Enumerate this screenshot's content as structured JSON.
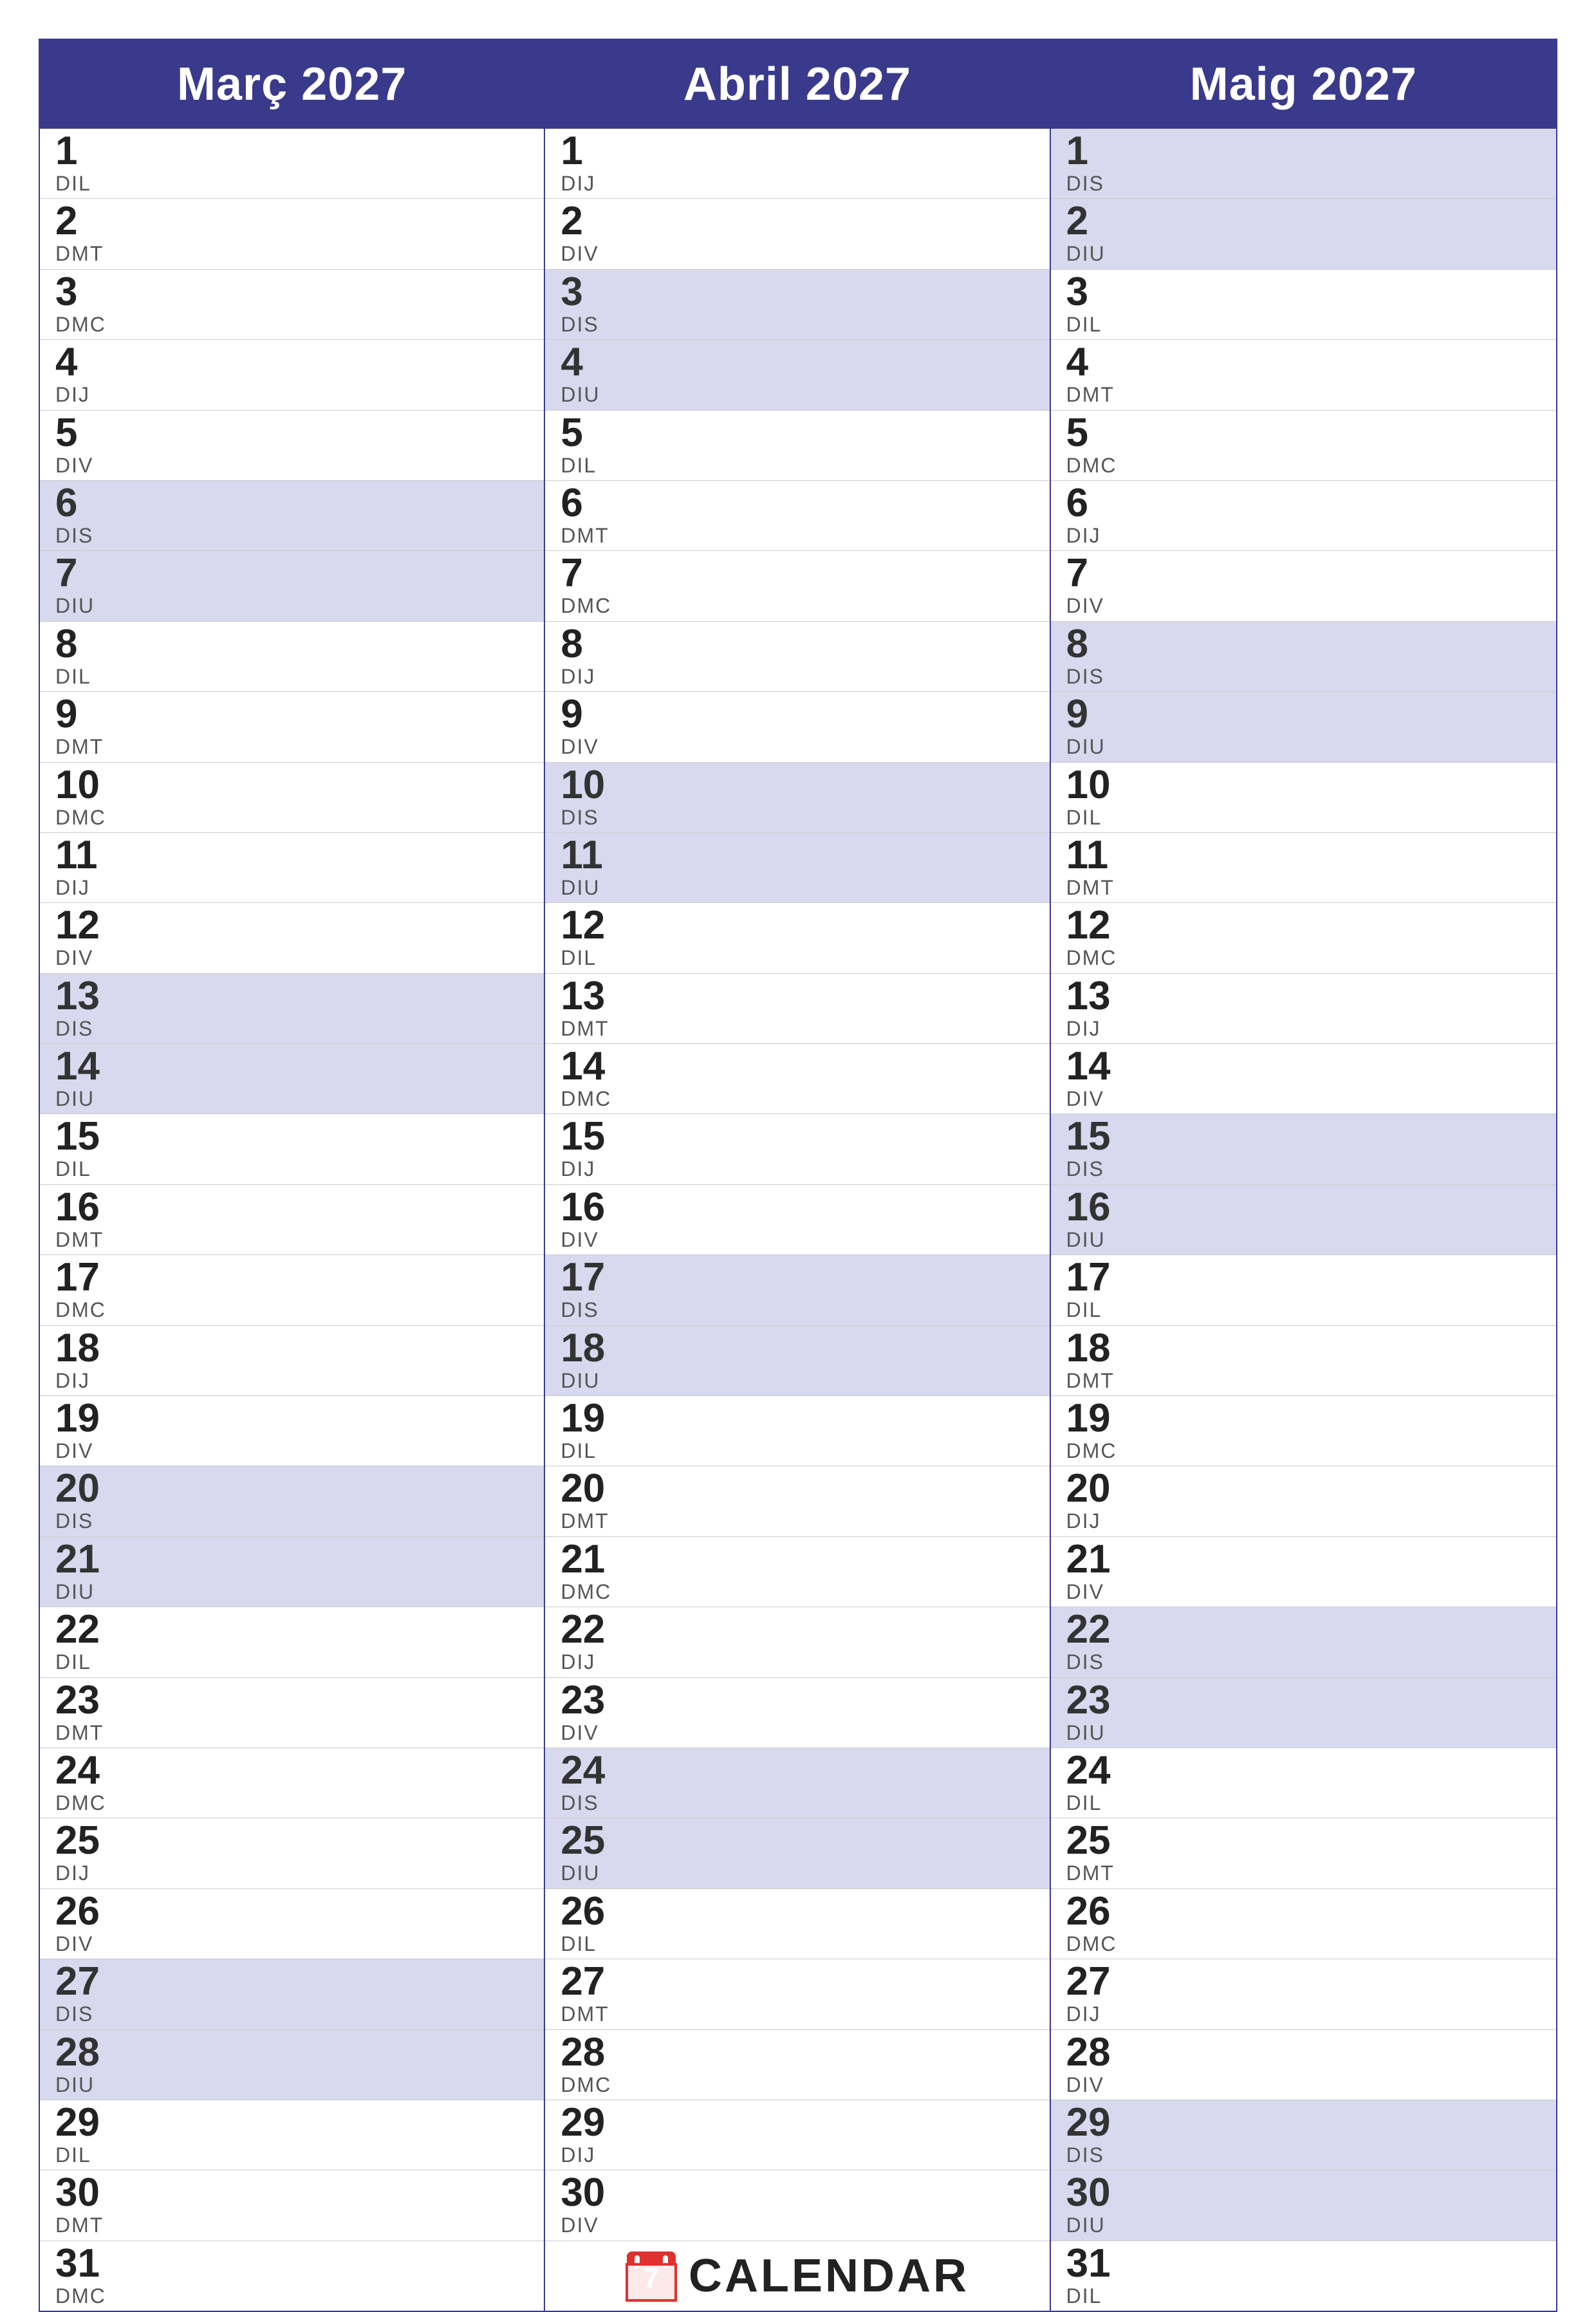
{
  "months": [
    {
      "name": "Març 2027",
      "days": [
        {
          "num": "1",
          "abbr": "DIL",
          "weekend": false
        },
        {
          "num": "2",
          "abbr": "DMT",
          "weekend": false
        },
        {
          "num": "3",
          "abbr": "DMC",
          "weekend": false
        },
        {
          "num": "4",
          "abbr": "DIJ",
          "weekend": false
        },
        {
          "num": "5",
          "abbr": "DIV",
          "weekend": false
        },
        {
          "num": "6",
          "abbr": "DIS",
          "weekend": true,
          "type": "sat"
        },
        {
          "num": "7",
          "abbr": "DIU",
          "weekend": true,
          "type": "sun"
        },
        {
          "num": "8",
          "abbr": "DIL",
          "weekend": false
        },
        {
          "num": "9",
          "abbr": "DMT",
          "weekend": false
        },
        {
          "num": "10",
          "abbr": "DMC",
          "weekend": false
        },
        {
          "num": "11",
          "abbr": "DIJ",
          "weekend": false
        },
        {
          "num": "12",
          "abbr": "DIV",
          "weekend": false
        },
        {
          "num": "13",
          "abbr": "DIS",
          "weekend": true,
          "type": "sat"
        },
        {
          "num": "14",
          "abbr": "DIU",
          "weekend": true,
          "type": "sun"
        },
        {
          "num": "15",
          "abbr": "DIL",
          "weekend": false
        },
        {
          "num": "16",
          "abbr": "DMT",
          "weekend": false
        },
        {
          "num": "17",
          "abbr": "DMC",
          "weekend": false
        },
        {
          "num": "18",
          "abbr": "DIJ",
          "weekend": false
        },
        {
          "num": "19",
          "abbr": "DIV",
          "weekend": false
        },
        {
          "num": "20",
          "abbr": "DIS",
          "weekend": true,
          "type": "sat"
        },
        {
          "num": "21",
          "abbr": "DIU",
          "weekend": true,
          "type": "sun"
        },
        {
          "num": "22",
          "abbr": "DIL",
          "weekend": false
        },
        {
          "num": "23",
          "abbr": "DMT",
          "weekend": false
        },
        {
          "num": "24",
          "abbr": "DMC",
          "weekend": false
        },
        {
          "num": "25",
          "abbr": "DIJ",
          "weekend": false
        },
        {
          "num": "26",
          "abbr": "DIV",
          "weekend": false
        },
        {
          "num": "27",
          "abbr": "DIS",
          "weekend": true,
          "type": "sat"
        },
        {
          "num": "28",
          "abbr": "DIU",
          "weekend": true,
          "type": "sun"
        },
        {
          "num": "29",
          "abbr": "DIL",
          "weekend": false
        },
        {
          "num": "30",
          "abbr": "DMT",
          "weekend": false
        },
        {
          "num": "31",
          "abbr": "DMC",
          "weekend": false
        }
      ]
    },
    {
      "name": "Abril 2027",
      "days": [
        {
          "num": "1",
          "abbr": "DIJ",
          "weekend": false
        },
        {
          "num": "2",
          "abbr": "DIV",
          "weekend": false
        },
        {
          "num": "3",
          "abbr": "DIS",
          "weekend": true,
          "type": "sat"
        },
        {
          "num": "4",
          "abbr": "DIU",
          "weekend": true,
          "type": "sun"
        },
        {
          "num": "5",
          "abbr": "DIL",
          "weekend": false
        },
        {
          "num": "6",
          "abbr": "DMT",
          "weekend": false
        },
        {
          "num": "7",
          "abbr": "DMC",
          "weekend": false
        },
        {
          "num": "8",
          "abbr": "DIJ",
          "weekend": false
        },
        {
          "num": "9",
          "abbr": "DIV",
          "weekend": false
        },
        {
          "num": "10",
          "abbr": "DIS",
          "weekend": true,
          "type": "sat"
        },
        {
          "num": "11",
          "abbr": "DIU",
          "weekend": true,
          "type": "sun"
        },
        {
          "num": "12",
          "abbr": "DIL",
          "weekend": false
        },
        {
          "num": "13",
          "abbr": "DMT",
          "weekend": false
        },
        {
          "num": "14",
          "abbr": "DMC",
          "weekend": false
        },
        {
          "num": "15",
          "abbr": "DIJ",
          "weekend": false
        },
        {
          "num": "16",
          "abbr": "DIV",
          "weekend": false
        },
        {
          "num": "17",
          "abbr": "DIS",
          "weekend": true,
          "type": "sat"
        },
        {
          "num": "18",
          "abbr": "DIU",
          "weekend": true,
          "type": "sun"
        },
        {
          "num": "19",
          "abbr": "DIL",
          "weekend": false
        },
        {
          "num": "20",
          "abbr": "DMT",
          "weekend": false
        },
        {
          "num": "21",
          "abbr": "DMC",
          "weekend": false
        },
        {
          "num": "22",
          "abbr": "DIJ",
          "weekend": false
        },
        {
          "num": "23",
          "abbr": "DIV",
          "weekend": false
        },
        {
          "num": "24",
          "abbr": "DIS",
          "weekend": true,
          "type": "sat"
        },
        {
          "num": "25",
          "abbr": "DIU",
          "weekend": true,
          "type": "sun"
        },
        {
          "num": "26",
          "abbr": "DIL",
          "weekend": false
        },
        {
          "num": "27",
          "abbr": "DMT",
          "weekend": false
        },
        {
          "num": "28",
          "abbr": "DMC",
          "weekend": false
        },
        {
          "num": "29",
          "abbr": "DIJ",
          "weekend": false
        },
        {
          "num": "30",
          "abbr": "DIV",
          "weekend": false
        }
      ]
    },
    {
      "name": "Maig 2027",
      "days": [
        {
          "num": "1",
          "abbr": "DIS",
          "weekend": true,
          "type": "sat"
        },
        {
          "num": "2",
          "abbr": "DIU",
          "weekend": true,
          "type": "sun"
        },
        {
          "num": "3",
          "abbr": "DIL",
          "weekend": false
        },
        {
          "num": "4",
          "abbr": "DMT",
          "weekend": false
        },
        {
          "num": "5",
          "abbr": "DMC",
          "weekend": false
        },
        {
          "num": "6",
          "abbr": "DIJ",
          "weekend": false
        },
        {
          "num": "7",
          "abbr": "DIV",
          "weekend": false
        },
        {
          "num": "8",
          "abbr": "DIS",
          "weekend": true,
          "type": "sat"
        },
        {
          "num": "9",
          "abbr": "DIU",
          "weekend": true,
          "type": "sun"
        },
        {
          "num": "10",
          "abbr": "DIL",
          "weekend": false
        },
        {
          "num": "11",
          "abbr": "DMT",
          "weekend": false
        },
        {
          "num": "12",
          "abbr": "DMC",
          "weekend": false
        },
        {
          "num": "13",
          "abbr": "DIJ",
          "weekend": false
        },
        {
          "num": "14",
          "abbr": "DIV",
          "weekend": false
        },
        {
          "num": "15",
          "abbr": "DIS",
          "weekend": true,
          "type": "sat"
        },
        {
          "num": "16",
          "abbr": "DIU",
          "weekend": true,
          "type": "sun"
        },
        {
          "num": "17",
          "abbr": "DIL",
          "weekend": false
        },
        {
          "num": "18",
          "abbr": "DMT",
          "weekend": false
        },
        {
          "num": "19",
          "abbr": "DMC",
          "weekend": false
        },
        {
          "num": "20",
          "abbr": "DIJ",
          "weekend": false
        },
        {
          "num": "21",
          "abbr": "DIV",
          "weekend": false
        },
        {
          "num": "22",
          "abbr": "DIS",
          "weekend": true,
          "type": "sat"
        },
        {
          "num": "23",
          "abbr": "DIU",
          "weekend": true,
          "type": "sun"
        },
        {
          "num": "24",
          "abbr": "DIL",
          "weekend": false
        },
        {
          "num": "25",
          "abbr": "DMT",
          "weekend": false
        },
        {
          "num": "26",
          "abbr": "DMC",
          "weekend": false
        },
        {
          "num": "27",
          "abbr": "DIJ",
          "weekend": false
        },
        {
          "num": "28",
          "abbr": "DIV",
          "weekend": false
        },
        {
          "num": "29",
          "abbr": "DIS",
          "weekend": true,
          "type": "sat"
        },
        {
          "num": "30",
          "abbr": "DIU",
          "weekend": true,
          "type": "sun"
        },
        {
          "num": "31",
          "abbr": "DIL",
          "weekend": false
        }
      ]
    }
  ],
  "brand": {
    "text": "CALENDAR",
    "accent_color": "#e03030"
  }
}
